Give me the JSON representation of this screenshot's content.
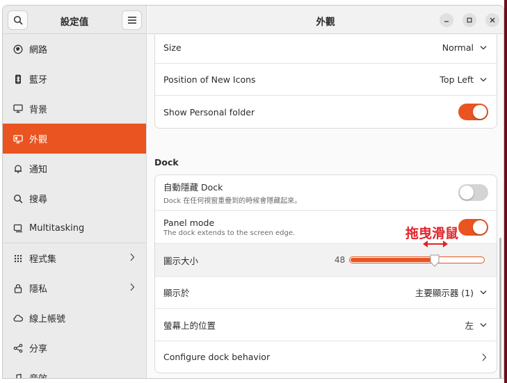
{
  "colors": {
    "accent": "#e95420",
    "annotation": "#e0242a"
  },
  "sidebar": {
    "title": "設定值",
    "search_icon": "search-icon",
    "menu_icon": "hamburger-menu-icon",
    "items": [
      {
        "label": "網路",
        "icon": "network-icon"
      },
      {
        "label": "藍牙",
        "icon": "bluetooth-icon"
      },
      {
        "label": "背景",
        "icon": "display-icon"
      },
      {
        "label": "外觀",
        "icon": "appearance-icon",
        "active": true
      },
      {
        "label": "通知",
        "icon": "bell-icon"
      },
      {
        "label": "搜尋",
        "icon": "search-icon"
      },
      {
        "label": "Multitasking",
        "icon": "multitasking-icon"
      },
      {
        "label": "程式集",
        "icon": "apps-grid-icon",
        "chevron": true
      },
      {
        "label": "隱私",
        "icon": "lock-icon",
        "chevron": true
      },
      {
        "label": "線上帳號",
        "icon": "cloud-icon"
      },
      {
        "label": "分享",
        "icon": "share-icon"
      },
      {
        "label": "音效",
        "icon": "music-icon"
      }
    ]
  },
  "main": {
    "title": "外觀",
    "window_buttons": [
      "minimize-icon",
      "maximize-icon",
      "close-icon"
    ],
    "icons_card": {
      "size": {
        "label": "Size",
        "value": "Normal"
      },
      "position": {
        "label": "Position of New Icons",
        "value": "Top Left"
      },
      "personal_folder": {
        "label": "Show Personal folder",
        "enabled": true
      }
    },
    "dock": {
      "section_title": "Dock",
      "autohide": {
        "label": "自動隱藏 Dock",
        "sublabel": "Dock 在任何視窗重疊到的時候會隱藏起來。",
        "enabled": false
      },
      "panel_mode": {
        "label": "Panel mode",
        "sublabel": "The dock extends to the screen edge.",
        "enabled": true
      },
      "icon_size": {
        "label": "圖示大小",
        "value": "48",
        "fraction": 0.63
      },
      "show_on": {
        "label": "顯示於",
        "value": "主要顯示器 (1)"
      },
      "screen_position": {
        "label": "螢幕上的位置",
        "value": "左"
      },
      "configure": {
        "label": "Configure dock behavior"
      }
    }
  },
  "annotation": {
    "text": "拖曳滑鼠"
  }
}
